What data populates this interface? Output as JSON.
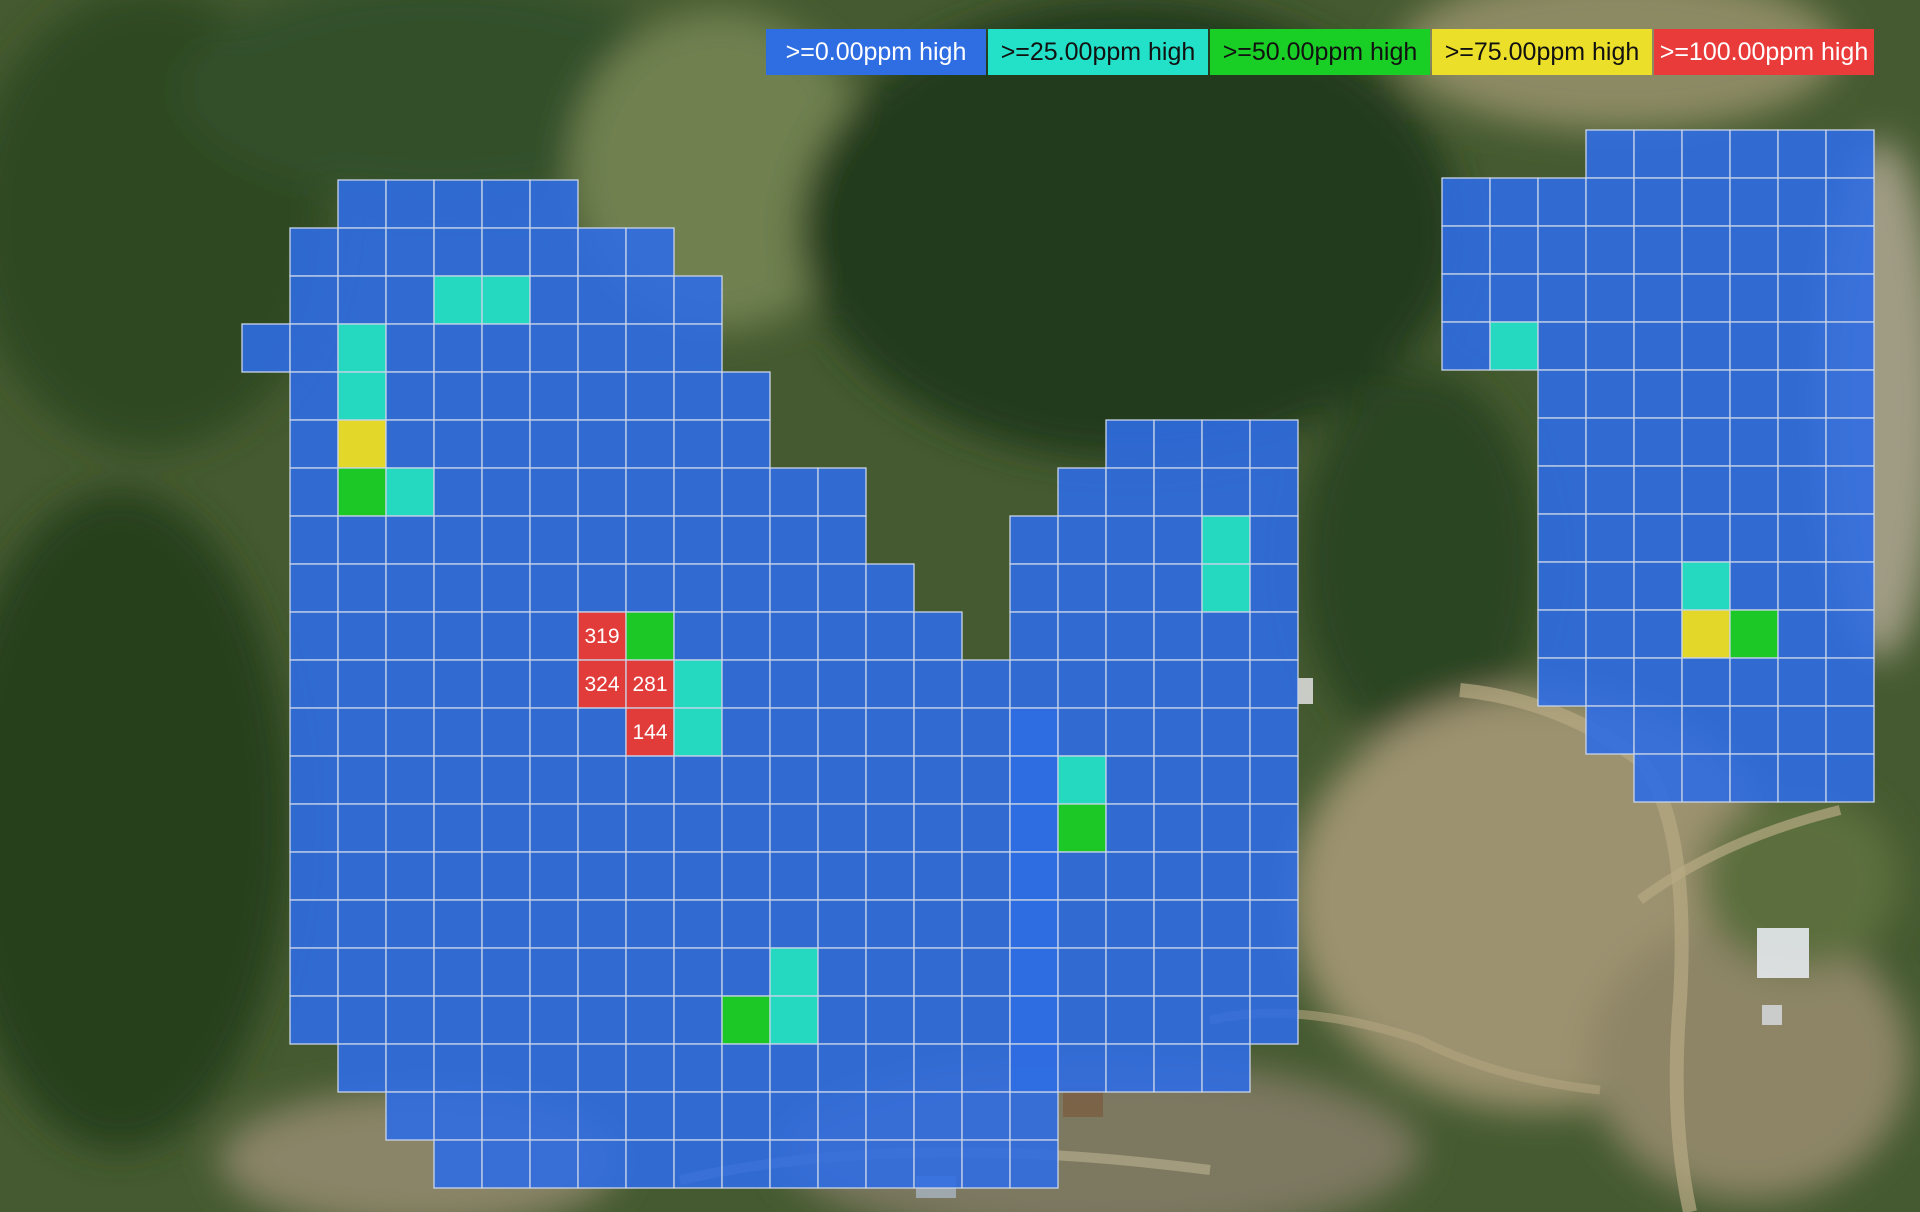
{
  "legend": [
    {
      "label": ">=0.00ppm high",
      "min_ppm": 0,
      "color": "#2f6de3",
      "text": "light"
    },
    {
      "label": ">=25.00ppm high",
      "min_ppm": 25,
      "color": "#23e0c8",
      "text": "dark"
    },
    {
      "label": ">=50.00ppm high",
      "min_ppm": 50,
      "color": "#19cf25",
      "text": "dark"
    },
    {
      "label": ">=75.00ppm high",
      "min_ppm": 75,
      "color": "#ecdf2a",
      "text": "dark"
    },
    {
      "label": ">=100.00ppm high",
      "min_ppm": 100,
      "color": "#ea3b3b",
      "text": "light"
    }
  ],
  "zones": [
    {
      "id": "west",
      "row_spans": [
        [
          1,
          5
        ],
        [
          0,
          7
        ],
        [
          0,
          8
        ],
        [
          -1,
          8
        ],
        [
          0,
          9
        ],
        [
          0,
          9
        ],
        [
          0,
          11
        ],
        [
          0,
          11
        ],
        [
          0,
          12
        ],
        [
          0,
          13
        ],
        [
          0,
          14
        ],
        [
          0,
          15
        ],
        [
          0,
          15
        ],
        [
          0,
          15
        ],
        [
          0,
          15
        ],
        [
          0,
          15
        ],
        [
          0,
          15
        ],
        [
          0,
          15
        ],
        [
          1,
          15
        ],
        [
          2,
          15
        ],
        [
          3,
          15
        ]
      ],
      "cells": [
        {
          "row": 2,
          "col": 3,
          "level": 1
        },
        {
          "row": 2,
          "col": 4,
          "level": 1
        },
        {
          "row": 3,
          "col": 1,
          "level": 1
        },
        {
          "row": 4,
          "col": 1,
          "level": 1
        },
        {
          "row": 5,
          "col": 1,
          "level": 3
        },
        {
          "row": 6,
          "col": 1,
          "level": 2
        },
        {
          "row": 6,
          "col": 2,
          "level": 1
        },
        {
          "row": 9,
          "col": 6,
          "level": 4,
          "value": "319"
        },
        {
          "row": 9,
          "col": 7,
          "level": 2
        },
        {
          "row": 10,
          "col": 6,
          "level": 4,
          "value": "324"
        },
        {
          "row": 10,
          "col": 7,
          "level": 4,
          "value": "281"
        },
        {
          "row": 10,
          "col": 8,
          "level": 1
        },
        {
          "row": 11,
          "col": 7,
          "level": 4,
          "value": "144"
        },
        {
          "row": 11,
          "col": 8,
          "level": 1
        },
        {
          "row": 16,
          "col": 10,
          "level": 1
        },
        {
          "row": 17,
          "col": 9,
          "level": 2
        },
        {
          "row": 17,
          "col": 10,
          "level": 1
        }
      ]
    },
    {
      "id": "middle",
      "row_spans": [
        [
          2,
          5
        ],
        [
          1,
          5
        ],
        [
          0,
          5
        ],
        [
          0,
          5
        ],
        [
          0,
          5
        ],
        [
          0,
          5
        ],
        [
          0,
          5
        ],
        [
          0,
          5
        ],
        [
          0,
          5
        ],
        [
          0,
          5
        ],
        [
          0,
          5
        ],
        [
          0,
          5
        ],
        [
          0,
          5
        ],
        [
          0,
          4
        ]
      ],
      "cells": [
        {
          "row": 2,
          "col": 4,
          "level": 1
        },
        {
          "row": 3,
          "col": 4,
          "level": 1
        },
        {
          "row": 7,
          "col": 1,
          "level": 1
        },
        {
          "row": 8,
          "col": 1,
          "level": 2
        }
      ]
    },
    {
      "id": "east",
      "row_spans": [
        [
          3,
          8
        ],
        [
          0,
          8
        ],
        [
          0,
          8
        ],
        [
          0,
          8
        ],
        [
          0,
          8
        ],
        [
          2,
          8
        ],
        [
          2,
          8
        ],
        [
          2,
          8
        ],
        [
          2,
          8
        ],
        [
          2,
          8
        ],
        [
          2,
          8
        ],
        [
          2,
          8
        ],
        [
          3,
          8
        ],
        [
          4,
          8
        ]
      ],
      "cells": [
        {
          "row": 4,
          "col": 1,
          "level": 1
        },
        {
          "row": 9,
          "col": 5,
          "level": 1
        },
        {
          "row": 10,
          "col": 5,
          "level": 3
        },
        {
          "row": 10,
          "col": 6,
          "level": 2
        }
      ]
    }
  ]
}
